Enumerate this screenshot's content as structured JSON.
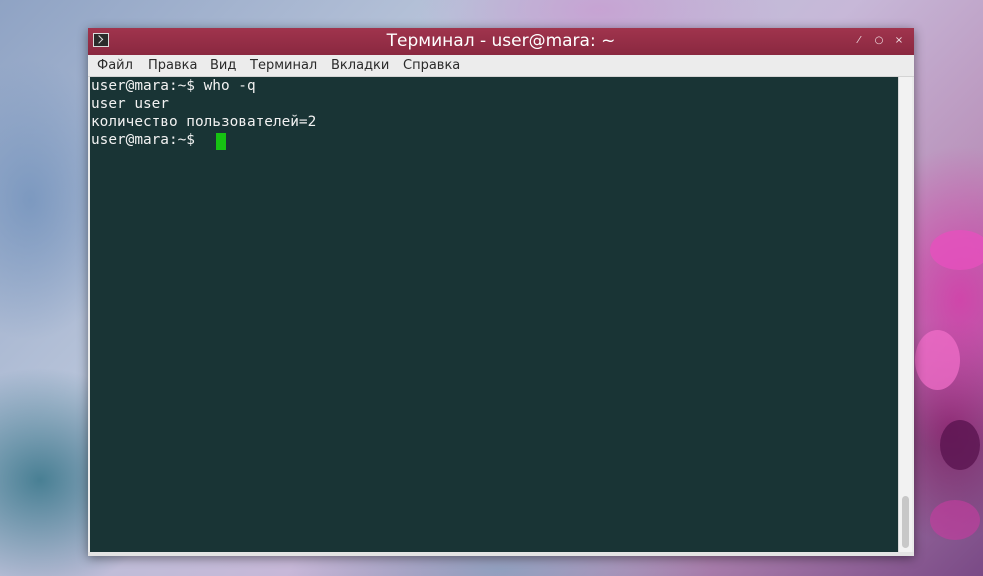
{
  "window": {
    "title": "Терминал - user@mara: ~",
    "app_icon": "terminal-icon",
    "controls": {
      "minimize": "⁄",
      "maximize": "○",
      "close": "×"
    },
    "title_bar_color": "#922d45"
  },
  "menu": {
    "items": [
      "Файл",
      "Правка",
      "Вид",
      "Терминал",
      "Вкладки",
      "Справка"
    ]
  },
  "terminal": {
    "background_color": "#193435",
    "text_color": "#f2f2f2",
    "cursor_color": "#16c212",
    "lines": [
      "user@mara:~$ who -q",
      "user user",
      "количество пользователей=2",
      "user@mara:~$ "
    ]
  }
}
